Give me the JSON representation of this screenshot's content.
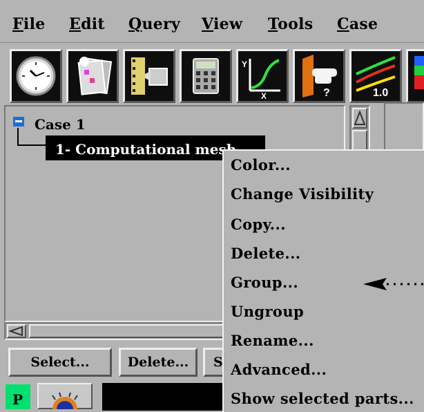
{
  "menubar": {
    "items": [
      {
        "label": "File",
        "underline": "F",
        "rest": "ile"
      },
      {
        "label": "Edit",
        "underline": "E",
        "rest": "dit"
      },
      {
        "label": "Query",
        "underline": "Q",
        "rest": "uery"
      },
      {
        "label": "View",
        "underline": "V",
        "rest": "iew"
      },
      {
        "label": "Tools",
        "underline": "T",
        "rest": "ools"
      },
      {
        "label": "Case",
        "underline": "C",
        "rest": "ase"
      }
    ]
  },
  "toolbar": {
    "icons": [
      "clock-icon",
      "portfolio-icon",
      "filmstrip-icon",
      "calculator-icon",
      "xy-plot-icon",
      "query-hand-icon",
      "color-legend-icon",
      "color-bar-icon"
    ],
    "legend_value": "1.0",
    "axis_y": "Y",
    "axis_x": "X",
    "query_mark": "?"
  },
  "tree": {
    "case_label": "Case 1",
    "part_label": "1- Computational mesh",
    "selected_color": "#000000"
  },
  "buttons": {
    "select": "Select...",
    "delete": "Delete...",
    "third": "S"
  },
  "context_menu": {
    "items": [
      "Color...",
      "Change Visibility",
      "Copy...",
      "Delete...",
      "Group...",
      "Ungroup",
      "Rename...",
      "Advanced...",
      "Show selected parts..."
    ]
  },
  "bottom": {
    "p_label": "P"
  },
  "colors": {
    "background": "#b4b4b4",
    "accent_green": "#00e070",
    "case_icon_blue": "#1e6ed8"
  }
}
